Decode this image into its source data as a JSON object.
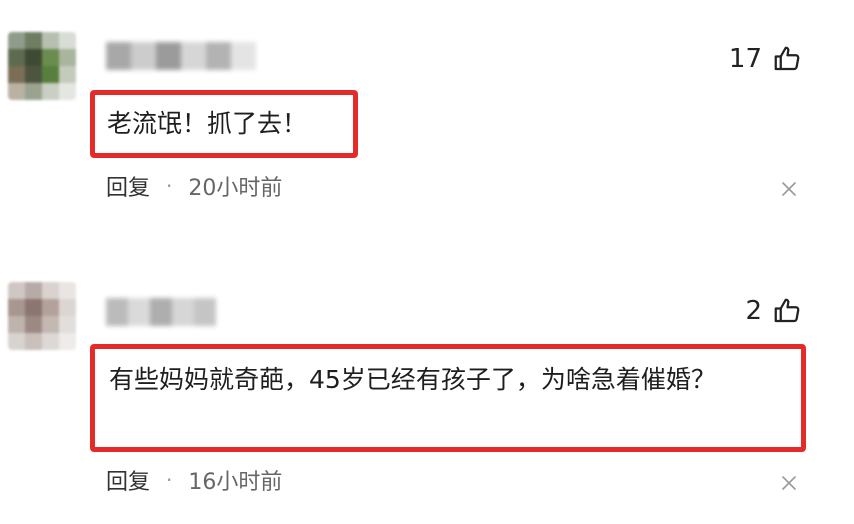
{
  "colors": {
    "highlight_border": "#e52a2a",
    "text": "#1e1e1e",
    "meta": "#666666"
  },
  "comments": [
    {
      "likes": "17",
      "text": "老流氓！抓了去！",
      "reply_label": "回复",
      "separator": "·",
      "time": "20小时前",
      "icons": {
        "like": "thumbs-up-icon",
        "dismiss": "close-icon"
      }
    },
    {
      "likes": "2",
      "text": "有些妈妈就奇葩，45岁已经有孩子了，为啥急着催婚？",
      "reply_label": "回复",
      "separator": "·",
      "time": "16小时前",
      "icons": {
        "like": "thumbs-up-icon",
        "dismiss": "close-icon"
      }
    }
  ]
}
